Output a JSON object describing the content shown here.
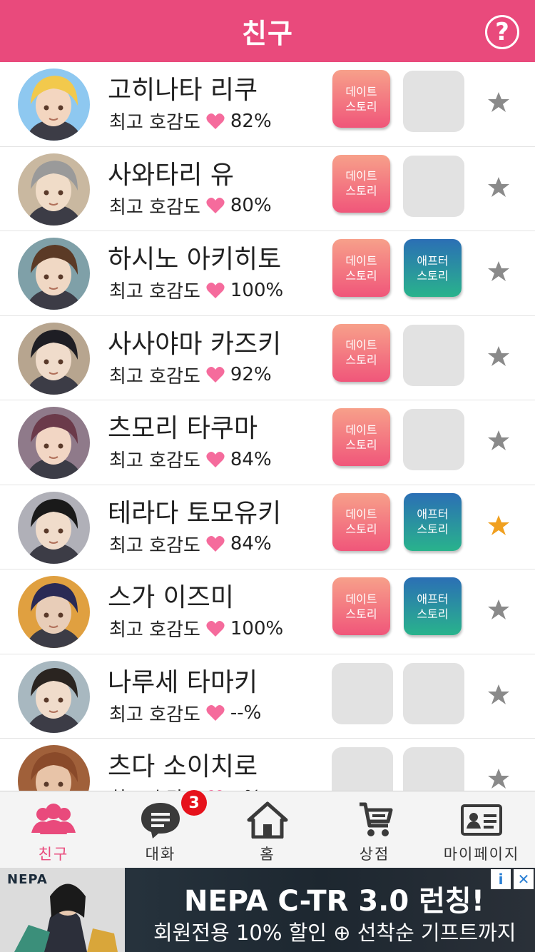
{
  "header": {
    "title": "친구",
    "help_icon": "question-circle-icon"
  },
  "affinity_label": "최고 호감도",
  "buttons": {
    "date_story": "데이트\n스토리",
    "after_story": "애프터\n스토리"
  },
  "friends": [
    {
      "name": "고히나타 리쿠",
      "affinity": "82%",
      "date": true,
      "after": false,
      "favorite": false
    },
    {
      "name": "사와타리 유",
      "affinity": "80%",
      "date": true,
      "after": false,
      "favorite": false
    },
    {
      "name": "하시노 아키히토",
      "affinity": "100%",
      "date": true,
      "after": true,
      "favorite": false
    },
    {
      "name": "사사야마 카즈키",
      "affinity": "92%",
      "date": true,
      "after": false,
      "favorite": false
    },
    {
      "name": "츠모리 타쿠마",
      "affinity": "84%",
      "date": true,
      "after": false,
      "favorite": false
    },
    {
      "name": "테라다 토모유키",
      "affinity": "84%",
      "date": true,
      "after": true,
      "favorite": true
    },
    {
      "name": "스가 이즈미",
      "affinity": "100%",
      "date": true,
      "after": true,
      "favorite": false
    },
    {
      "name": "나루세 타마키",
      "affinity": "--%",
      "date": false,
      "after": false,
      "favorite": false
    },
    {
      "name": "츠다 소이치로",
      "affinity": "--%",
      "date": false,
      "after": false,
      "favorite": false
    }
  ],
  "tabbar": {
    "items": [
      {
        "label": "친구",
        "icon": "friends-icon",
        "active": true
      },
      {
        "label": "대화",
        "icon": "chat-bubble-icon",
        "badge": "3"
      },
      {
        "label": "홈",
        "icon": "home-icon"
      },
      {
        "label": "상점",
        "icon": "shopping-cart-icon"
      },
      {
        "label": "마이페이지",
        "icon": "id-card-icon"
      }
    ]
  },
  "ad": {
    "brand": "NEPA",
    "headline": "NEPA C-TR 3.0 런칭!",
    "sub": "회원전용 10% 할인 ⊕ 선착순 기프트까지",
    "info_icon": "info-icon",
    "close_icon": "close-icon"
  },
  "colors": {
    "accent": "#e94a7c",
    "date_btn_top": "#f7a08a",
    "date_btn_bottom": "#f0567a",
    "after_btn_top": "#2b6fb5",
    "after_btn_bottom": "#29b38c",
    "star_active": "#f0a020",
    "star_inactive": "#8a8a8a",
    "heart": "#f56b9c"
  }
}
